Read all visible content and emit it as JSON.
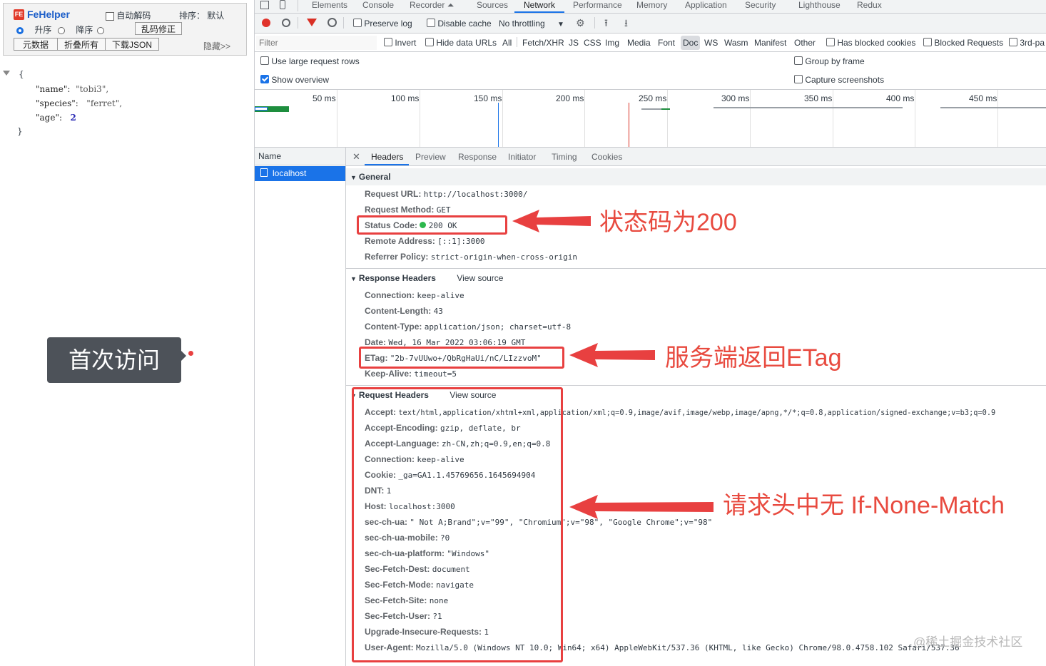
{
  "fehelper": {
    "logo_icon": "FE",
    "title": "FeHelper",
    "auto_decode": "自动解码",
    "sort_label": "排序：",
    "sort_default": "默认",
    "asc": "升序",
    "desc": "降序",
    "fix_encoding": "乱码修正",
    "btn_raw": "元数据",
    "btn_fold": "折叠所有",
    "btn_download": "下载JSON",
    "hide": "隐藏>>"
  },
  "json_view": {
    "open": "{",
    "close": "}",
    "lines": [
      {
        "key": "\"name\":",
        "value": "\"tobi3\",",
        "type": "string"
      },
      {
        "key": "\"species\":",
        "value": "\"ferret\",",
        "type": "string"
      },
      {
        "key": "\"age\":",
        "value": "2",
        "type": "number"
      }
    ]
  },
  "callout": "首次访问",
  "devtools": {
    "tabs": [
      "Elements",
      "Console",
      "Recorder ⏶",
      "Sources",
      "Network",
      "Performance",
      "Memory",
      "Application",
      "Security",
      "Lighthouse",
      "Redux"
    ],
    "active_tab": "Network",
    "toolbar": {
      "preserve_log": "Preserve log",
      "disable_cache": "Disable cache",
      "throttling": "No throttling"
    },
    "filter": {
      "placeholder": "Filter",
      "invert": "Invert",
      "hide_data_urls": "Hide data URLs",
      "types": [
        "All",
        "Fetch/XHR",
        "JS",
        "CSS",
        "Img",
        "Media",
        "Font",
        "Doc",
        "WS",
        "Wasm",
        "Manifest",
        "Other"
      ],
      "active_type": "Doc",
      "has_blocked_cookies": "Has blocked cookies",
      "blocked_requests": "Blocked Requests",
      "third_party": "3rd-pa"
    },
    "options": {
      "large_rows": "Use large request rows",
      "show_overview": "Show overview",
      "group_by_frame": "Group by frame",
      "capture_screenshots": "Capture screenshots"
    },
    "timeline_ticks": [
      "50 ms",
      "100 ms",
      "150 ms",
      "200 ms",
      "250 ms",
      "300 ms",
      "350 ms",
      "400 ms",
      "450 ms"
    ],
    "name_header": "Name",
    "requests": [
      "localhost"
    ],
    "detail_tabs": [
      "Headers",
      "Preview",
      "Response",
      "Initiator",
      "Timing",
      "Cookies"
    ],
    "active_detail_tab": "Headers",
    "general": {
      "title": "General",
      "rows": [
        {
          "k": "Request URL:",
          "v": "http://localhost:3000/"
        },
        {
          "k": "Request Method:",
          "v": "GET"
        },
        {
          "k": "Status Code:",
          "v": "200 OK"
        },
        {
          "k": "Remote Address:",
          "v": "[::1]:3000"
        },
        {
          "k": "Referrer Policy:",
          "v": "strict-origin-when-cross-origin"
        }
      ]
    },
    "response_headers": {
      "title": "Response Headers",
      "view_source": "View source",
      "rows": [
        {
          "k": "Connection:",
          "v": "keep-alive"
        },
        {
          "k": "Content-Length:",
          "v": "43"
        },
        {
          "k": "Content-Type:",
          "v": "application/json; charset=utf-8"
        },
        {
          "k": "Date:",
          "v": "Wed, 16 Mar 2022 03:06:19 GMT"
        },
        {
          "k": "ETag:",
          "v": "\"2b-7vUUwo+/QbRgHaUi/nC/LIzzvoM\""
        },
        {
          "k": "Keep-Alive:",
          "v": "timeout=5"
        }
      ]
    },
    "request_headers": {
      "title": "Request Headers",
      "view_source": "View source",
      "rows": [
        {
          "k": "Accept:",
          "v": "text/html,application/xhtml+xml,application/xml;q=0.9,image/avif,image/webp,image/apng,*/*;q=0.8,application/signed-exchange;v=b3;q=0.9"
        },
        {
          "k": "Accept-Encoding:",
          "v": "gzip, deflate, br"
        },
        {
          "k": "Accept-Language:",
          "v": "zh-CN,zh;q=0.9,en;q=0.8"
        },
        {
          "k": "Connection:",
          "v": "keep-alive"
        },
        {
          "k": "Cookie:",
          "v": "_ga=GA1.1.45769656.1645694904"
        },
        {
          "k": "DNT:",
          "v": "1"
        },
        {
          "k": "Host:",
          "v": "localhost:3000"
        },
        {
          "k": "sec-ch-ua:",
          "v": "\" Not A;Brand\";v=\"99\", \"Chromium\";v=\"98\", \"Google Chrome\";v=\"98\""
        },
        {
          "k": "sec-ch-ua-mobile:",
          "v": "?0"
        },
        {
          "k": "sec-ch-ua-platform:",
          "v": "\"Windows\""
        },
        {
          "k": "Sec-Fetch-Dest:",
          "v": "document"
        },
        {
          "k": "Sec-Fetch-Mode:",
          "v": "navigate"
        },
        {
          "k": "Sec-Fetch-Site:",
          "v": "none"
        },
        {
          "k": "Sec-Fetch-User:",
          "v": "?1"
        },
        {
          "k": "Upgrade-Insecure-Requests:",
          "v": "1"
        },
        {
          "k": "User-Agent:",
          "v": "Mozilla/5.0 (Windows NT 10.0; Win64; x64) AppleWebKit/537.36 (KHTML, like Gecko) Chrome/98.0.4758.102 Safari/537.36"
        }
      ]
    }
  },
  "annotations": {
    "status": "状态码为200",
    "etag": "服务端返回ETag",
    "no_if_none_match": "请求头中无 If-None-Match"
  },
  "watermark": "@稀土掘金技术社区",
  "colors": {
    "accent": "#1a73e8",
    "annotation": "#e84a3f",
    "status_ok": "#2db84d",
    "record": "#e0322b"
  }
}
